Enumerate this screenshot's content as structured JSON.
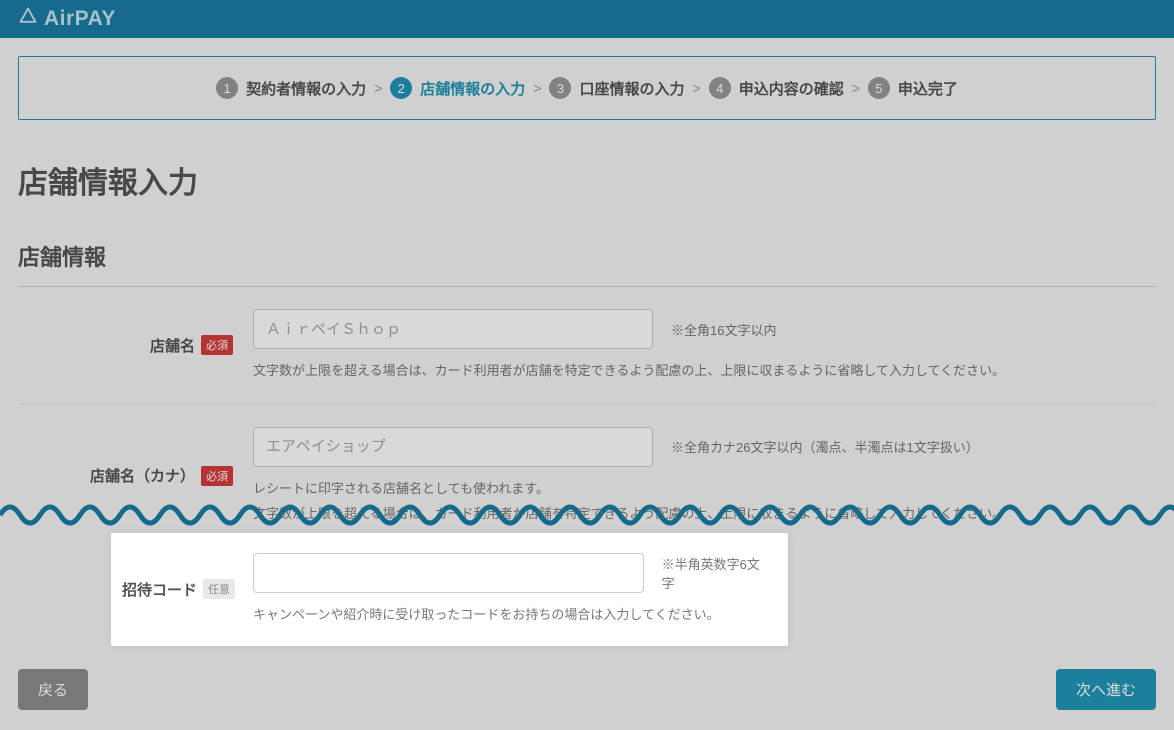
{
  "header": {
    "brand": "AirPAY"
  },
  "stepper": {
    "steps": [
      {
        "num": "1",
        "label": "契約者情報の入力"
      },
      {
        "num": "2",
        "label": "店舗情報の入力"
      },
      {
        "num": "3",
        "label": "口座情報の入力"
      },
      {
        "num": "4",
        "label": "申込内容の確認"
      },
      {
        "num": "5",
        "label": "申込完了"
      }
    ],
    "activeIndex": 1
  },
  "page": {
    "title": "店舗情報入力",
    "sectionTitle": "店舗情報"
  },
  "fields": {
    "storeName": {
      "label": "店舗名",
      "badge": "必須",
      "placeholder": "ＡｉｒペイＳｈｏｐ",
      "value": "",
      "hint": "※全角16文字以内",
      "desc": "文字数が上限を超える場合は、カード利用者が店舗を特定できるよう配慮の上、上限に収まるように省略して入力してください。"
    },
    "storeNameKana": {
      "label": "店舗名（カナ）",
      "badge": "必須",
      "placeholder": "エアペイショップ",
      "value": "",
      "hint": "※全角カナ26文字以内（濁点、半濁点は1文字扱い）",
      "desc1": "レシートに印字される店舗名としても使われます。",
      "desc2": "文字数が上限を超える場合は、カード利用者が店舗を特定できるよう配慮の上、上限に収まるように省略して入力してください。"
    },
    "inviteCode": {
      "label": "招待コード",
      "badge": "任意",
      "placeholder": "",
      "value": "",
      "hint": "※半角英数字6文字",
      "desc": "キャンペーンや紹介時に受け取ったコードをお持ちの場合は入力してください。"
    }
  },
  "buttons": {
    "back": "戻る",
    "next": "次へ進む"
  }
}
